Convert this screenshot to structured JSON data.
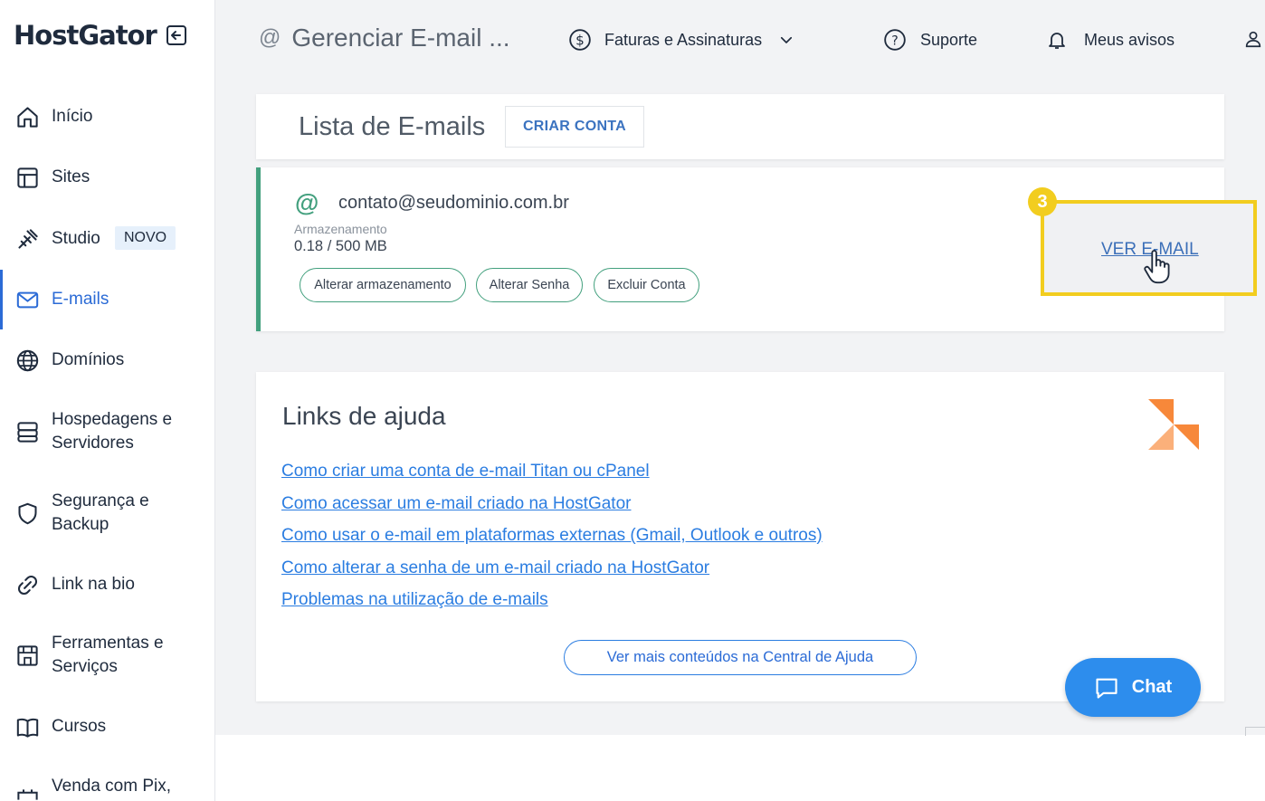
{
  "brand": {
    "name": "HostGator"
  },
  "sidebar": {
    "items": [
      {
        "label": "Início",
        "icon": "home-icon"
      },
      {
        "label": "Sites",
        "icon": "layout-icon"
      },
      {
        "label": "Studio",
        "icon": "tools-icon",
        "badge": "NOVO"
      },
      {
        "label": "E-mails",
        "icon": "mail-icon",
        "active": true
      },
      {
        "label": "Domínios",
        "icon": "globe-icon"
      },
      {
        "label": "Hospedagens e",
        "label2": "Servidores",
        "icon": "server-icon"
      },
      {
        "label": "Segurança e",
        "label2": "Backup",
        "icon": "shield-icon"
      },
      {
        "label": "Link na bio",
        "icon": "link-icon"
      },
      {
        "label": "Ferramentas e",
        "label2": "Serviços",
        "icon": "store-icon"
      },
      {
        "label": "Cursos",
        "icon": "book-icon"
      },
      {
        "label": "Venda com Pix,",
        "icon": "pix-icon"
      }
    ]
  },
  "header": {
    "title": "Gerenciar E-mail ...",
    "billing": "Faturas e Assinaturas",
    "support": "Suporte",
    "notices": "Meus avisos"
  },
  "email_list": {
    "title": "Lista de E-mails",
    "create_button": "CRIAR CONTA"
  },
  "account": {
    "address": "contato@seudominio.com.br",
    "storage_label": "Armazenamento",
    "storage_value": "0.18 / 500 MB",
    "actions": [
      "Alterar armazenamento",
      "Alterar Senha",
      "Excluir Conta"
    ],
    "view_label": "VER E-MAIL",
    "step_number": "3"
  },
  "help": {
    "title": "Links de ajuda",
    "links": [
      "Como criar uma conta de e-mail Titan ou cPanel",
      "Como acessar um e-mail criado na HostGator",
      "Como usar o e-mail em plataformas externas (Gmail, Outlook e outros)",
      "Como alterar a senha de um e-mail criado na HostGator",
      "Problemas na utilização de e-mails"
    ],
    "more_button": "Ver mais conteúdos na Central de Ajuda"
  },
  "chat": {
    "label": "Chat"
  },
  "colors": {
    "accent_blue": "#2b6bd6",
    "green": "#43a07e",
    "highlight_yellow": "#f2cd1f",
    "chat_blue": "#2d8ded",
    "orange": "#f7883a"
  }
}
